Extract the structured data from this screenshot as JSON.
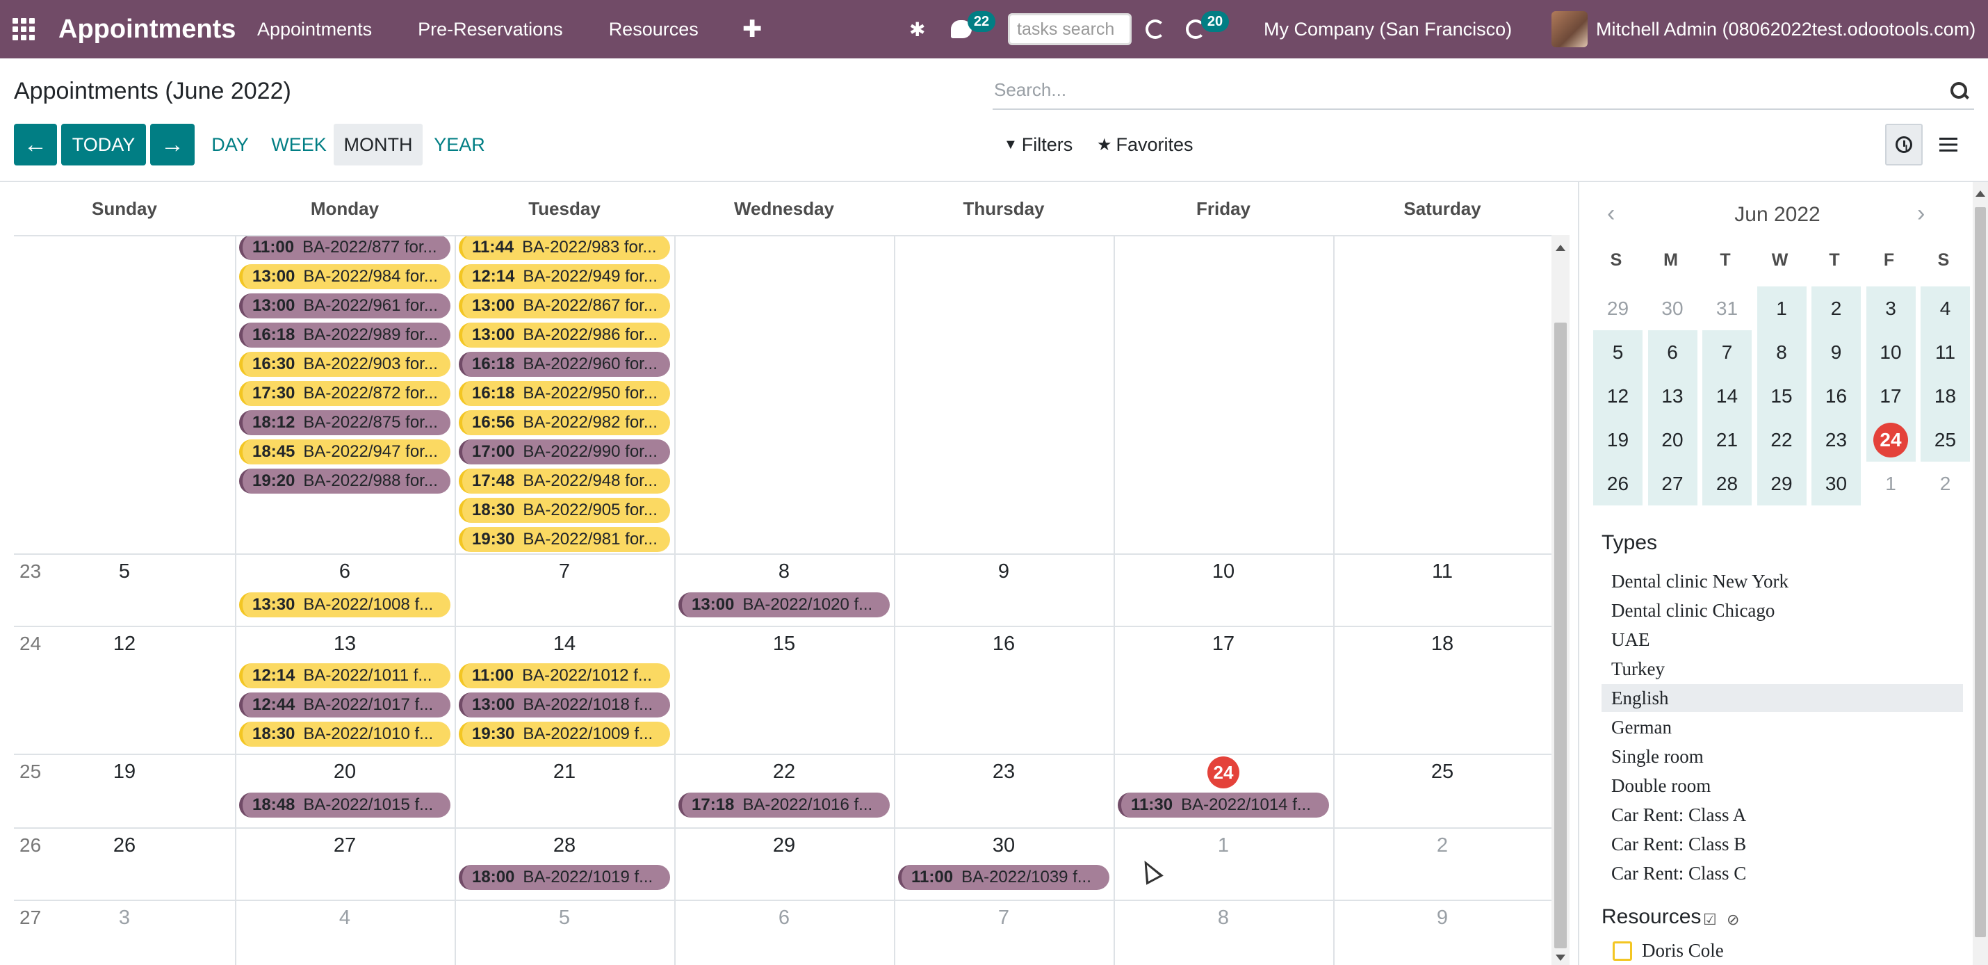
{
  "navbar": {
    "brand": "Appointments",
    "menu": [
      "Appointments",
      "Pre-Reservations",
      "Resources"
    ],
    "plus": "✚",
    "chat_badge": "22",
    "tasks_search_placeholder": "tasks search",
    "activity_badge": "20",
    "company": "My Company (San Francisco)",
    "user": "Mitchell Admin (08062022test.odootools.com)"
  },
  "control": {
    "title": "Appointments (June 2022)",
    "search_placeholder": "Search...",
    "prev": "←",
    "today": "TODAY",
    "next": "→",
    "scales": [
      "DAY",
      "WEEK",
      "MONTH",
      "YEAR"
    ],
    "active_scale": "MONTH",
    "filters": "Filters",
    "favorites": "Favorites"
  },
  "calendar": {
    "day_headers": [
      "Sunday",
      "Monday",
      "Tuesday",
      "Wednesday",
      "Thursday",
      "Friday",
      "Saturday"
    ],
    "weeks": [
      {
        "week": "23",
        "days": [
          "5",
          "6",
          "7",
          "8",
          "9",
          "10",
          "11"
        ],
        "muted": [],
        "today": null
      },
      {
        "week": "24",
        "days": [
          "12",
          "13",
          "14",
          "15",
          "16",
          "17",
          "18"
        ],
        "muted": [],
        "today": null
      },
      {
        "week": "25",
        "days": [
          "19",
          "20",
          "21",
          "22",
          "23",
          "24",
          "25"
        ],
        "muted": [],
        "today": 5
      },
      {
        "week": "26",
        "days": [
          "26",
          "27",
          "28",
          "29",
          "30",
          "1",
          "2"
        ],
        "muted": [
          5,
          6
        ],
        "today": null
      },
      {
        "week": "27",
        "days": [
          "3",
          "4",
          "5",
          "6",
          "7",
          "8",
          "9"
        ],
        "muted": [
          0,
          1,
          2,
          3,
          4,
          5,
          6
        ],
        "today": null
      }
    ],
    "events": [
      {
        "week": 0,
        "day": 1,
        "slot": 0,
        "time": "11:00",
        "label": "BA-2022/877 for...",
        "color": "purple"
      },
      {
        "week": 0,
        "day": 1,
        "slot": 1,
        "time": "13:00",
        "label": "BA-2022/984 for...",
        "color": "yellow"
      },
      {
        "week": 0,
        "day": 1,
        "slot": 2,
        "time": "13:00",
        "label": "BA-2022/961 for...",
        "color": "purple"
      },
      {
        "week": 0,
        "day": 1,
        "slot": 3,
        "time": "16:18",
        "label": "BA-2022/989 for...",
        "color": "purple"
      },
      {
        "week": 0,
        "day": 1,
        "slot": 4,
        "time": "16:30",
        "label": "BA-2022/903 for...",
        "color": "yellow"
      },
      {
        "week": 0,
        "day": 1,
        "slot": 5,
        "time": "17:30",
        "label": "BA-2022/872 for...",
        "color": "yellow"
      },
      {
        "week": 0,
        "day": 1,
        "slot": 6,
        "time": "18:12",
        "label": "BA-2022/875 for...",
        "color": "purple"
      },
      {
        "week": 0,
        "day": 1,
        "slot": 7,
        "time": "18:45",
        "label": "BA-2022/947 for...",
        "color": "yellow"
      },
      {
        "week": 0,
        "day": 1,
        "slot": 8,
        "time": "19:20",
        "label": "BA-2022/988 for...",
        "color": "purple"
      },
      {
        "week": 0,
        "day": 2,
        "slot": 0,
        "time": "11:44",
        "label": "BA-2022/983 for...",
        "color": "yellow"
      },
      {
        "week": 0,
        "day": 2,
        "slot": 1,
        "time": "12:14",
        "label": "BA-2022/949 for...",
        "color": "yellow"
      },
      {
        "week": 0,
        "day": 2,
        "slot": 2,
        "time": "13:00",
        "label": "BA-2022/867 for...",
        "color": "yellow"
      },
      {
        "week": 0,
        "day": 2,
        "slot": 3,
        "time": "13:00",
        "label": "BA-2022/986 for...",
        "color": "yellow"
      },
      {
        "week": 0,
        "day": 2,
        "slot": 4,
        "time": "16:18",
        "label": "BA-2022/960 for...",
        "color": "purple"
      },
      {
        "week": 0,
        "day": 2,
        "slot": 5,
        "time": "16:18",
        "label": "BA-2022/950 for...",
        "color": "yellow"
      },
      {
        "week": 0,
        "day": 2,
        "slot": 6,
        "time": "16:56",
        "label": "BA-2022/982 for...",
        "color": "yellow"
      },
      {
        "week": 0,
        "day": 2,
        "slot": 7,
        "time": "17:00",
        "label": "BA-2022/990 for...",
        "color": "purple"
      },
      {
        "week": 0,
        "day": 2,
        "slot": 8,
        "time": "17:48",
        "label": "BA-2022/948 for...",
        "color": "yellow"
      },
      {
        "week": 0,
        "day": 2,
        "slot": 9,
        "time": "18:30",
        "label": "BA-2022/905 for...",
        "color": "yellow"
      },
      {
        "week": 0,
        "day": 2,
        "slot": 10,
        "time": "19:30",
        "label": "BA-2022/981 for...",
        "color": "yellow"
      },
      {
        "week": 1,
        "day": 1,
        "slot": 0,
        "time": "13:30",
        "label": "BA-2022/1008 f...",
        "color": "yellow"
      },
      {
        "week": 1,
        "day": 3,
        "slot": 0,
        "time": "13:00",
        "label": "BA-2022/1020 f...",
        "color": "purple"
      },
      {
        "week": 2,
        "day": 1,
        "slot": 0,
        "time": "12:14",
        "label": "BA-2022/1011 f...",
        "color": "yellow"
      },
      {
        "week": 2,
        "day": 1,
        "slot": 1,
        "time": "12:44",
        "label": "BA-2022/1017 f...",
        "color": "purple"
      },
      {
        "week": 2,
        "day": 1,
        "slot": 2,
        "time": "18:30",
        "label": "BA-2022/1010 f...",
        "color": "yellow"
      },
      {
        "week": 2,
        "day": 2,
        "slot": 0,
        "time": "11:00",
        "label": "BA-2022/1012 f...",
        "color": "yellow"
      },
      {
        "week": 2,
        "day": 2,
        "slot": 1,
        "time": "13:00",
        "label": "BA-2022/1018 f...",
        "color": "purple"
      },
      {
        "week": 2,
        "day": 2,
        "slot": 2,
        "time": "19:30",
        "label": "BA-2022/1009 f...",
        "color": "yellow"
      },
      {
        "week": 3,
        "day": 1,
        "slot": 0,
        "time": "18:48",
        "label": "BA-2022/1015 f...",
        "color": "purple"
      },
      {
        "week": 3,
        "day": 3,
        "slot": 0,
        "time": "17:18",
        "label": "BA-2022/1016 f...",
        "color": "purple"
      },
      {
        "week": 3,
        "day": 5,
        "slot": 0,
        "time": "11:30",
        "label": "BA-2022/1014 f...",
        "color": "purple"
      },
      {
        "week": 4,
        "day": 2,
        "slot": 0,
        "time": "18:00",
        "label": "BA-2022/1019 f...",
        "color": "purple"
      },
      {
        "week": 4,
        "day": 4,
        "slot": 0,
        "time": "11:00",
        "label": "BA-2022/1039 f...",
        "color": "purple"
      }
    ]
  },
  "sidebar": {
    "mini_title": "Jun 2022",
    "prev": "‹",
    "next": "›",
    "dow": [
      "S",
      "M",
      "T",
      "W",
      "T",
      "F",
      "S"
    ],
    "mini_weeks": [
      [
        "29",
        "30",
        "31",
        "1",
        "2",
        "3",
        "4"
      ],
      [
        "5",
        "6",
        "7",
        "8",
        "9",
        "10",
        "11"
      ],
      [
        "12",
        "13",
        "14",
        "15",
        "16",
        "17",
        "18"
      ],
      [
        "19",
        "20",
        "21",
        "22",
        "23",
        "24",
        "25"
      ],
      [
        "26",
        "27",
        "28",
        "29",
        "30",
        "1",
        "2"
      ]
    ],
    "types_title": "Types",
    "types": [
      "Dental clinic New York",
      "Dental clinic Chicago",
      "UAE",
      "Turkey",
      "English",
      "German",
      "Single room",
      "Double room",
      "Car Rent: Class A",
      "Car Rent: Class B",
      "Car Rent: Class C"
    ],
    "active_type": "English",
    "resources_title": "Resources",
    "resources": [
      "Doris Cole"
    ]
  },
  "colors": {
    "navbar": "#714b67",
    "primary": "#017e84",
    "event_purple": "#a57f98",
    "event_yellow": "#fbd962",
    "today": "#e4423a",
    "mini_month_bg": "#e1f0f0"
  }
}
